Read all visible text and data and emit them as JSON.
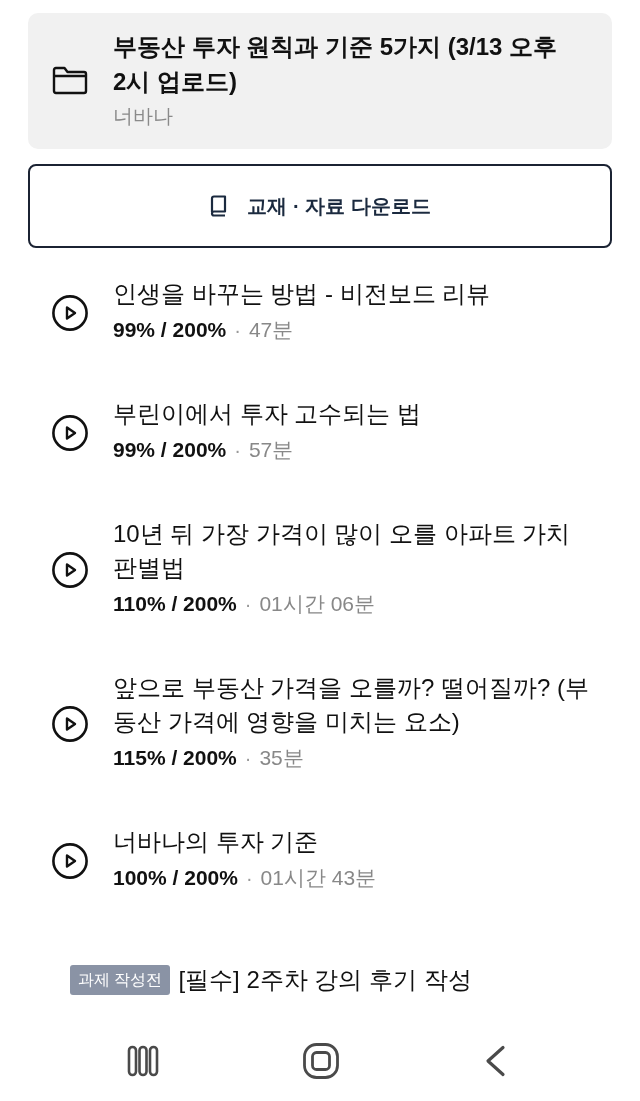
{
  "folder": {
    "title": "부동산 투자 원칙과 기준 5가지 (3/13 오후 2시 업로드)",
    "author": "너바나"
  },
  "download_button": {
    "label": "교재 · 자료 다운로드"
  },
  "lectures": [
    {
      "title": "인생을 바꾸는 방법 - 비전보드 리뷰",
      "progress": "99% / 200%",
      "separator": "·",
      "duration": "47분"
    },
    {
      "title": "부린이에서 투자 고수되는 법",
      "progress": "99% / 200%",
      "separator": "·",
      "duration": "57분"
    },
    {
      "title": "10년 뒤 가장 가격이 많이 오를 아파트 가치 판별법",
      "progress": "110% / 200%",
      "separator": "·",
      "duration": "01시간 06분"
    },
    {
      "title": "앞으로 부동산 가격을 오를까? 떨어질까? (부동산 가격에 영향을 미치는 요소)",
      "progress": "115% / 200%",
      "separator": "·",
      "duration": "35분"
    },
    {
      "title": "너바나의 투자 기준",
      "progress": "100% / 200%",
      "separator": "·",
      "duration": "01시간 43분"
    }
  ],
  "assignment": {
    "status": "과제 작성전",
    "title": "[필수] 2주차 강의 후기 작성"
  }
}
